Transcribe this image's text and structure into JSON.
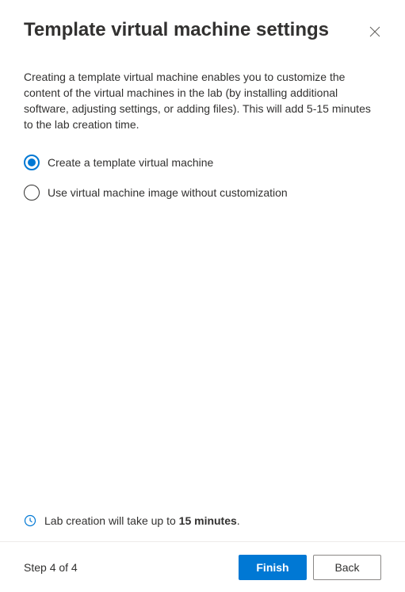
{
  "header": {
    "title": "Template virtual machine settings"
  },
  "description": "Creating a template virtual machine enables you to customize the content of the virtual machines in the lab (by installing additional software, adjusting settings, or adding files). This will add 5-15 minutes to the lab creation time.",
  "options": {
    "create_template": "Create a template virtual machine",
    "use_image": "Use virtual machine image without customization",
    "selected": "create_template"
  },
  "info": {
    "prefix": "Lab creation will take up to ",
    "bold": "15 minutes",
    "suffix": "."
  },
  "footer": {
    "step_label": "Step 4 of 4",
    "finish": "Finish",
    "back": "Back"
  },
  "colors": {
    "accent": "#0078d4"
  }
}
